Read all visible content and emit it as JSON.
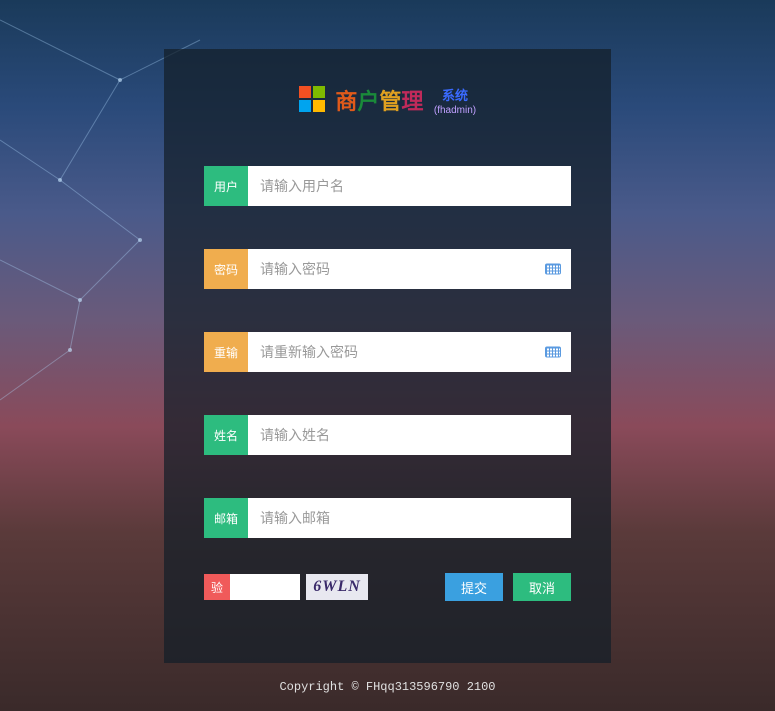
{
  "title": {
    "c1": "商",
    "c2": "户",
    "c3": "管",
    "c4": "理",
    "sub1": "系统",
    "sub2": "(fhadmin)"
  },
  "fields": {
    "username": {
      "label": "用户",
      "placeholder": "请输入用户名",
      "color": "green"
    },
    "password": {
      "label": "密码",
      "placeholder": "请输入密码",
      "color": "orange"
    },
    "repassword": {
      "label": "重输",
      "placeholder": "请重新输入密码",
      "color": "orange"
    },
    "realname": {
      "label": "姓名",
      "placeholder": "请输入姓名",
      "color": "green"
    },
    "email": {
      "label": "邮箱",
      "placeholder": "请输入邮箱",
      "color": "green"
    }
  },
  "captcha": {
    "label": "验",
    "code": "6WLN"
  },
  "buttons": {
    "submit": "提交",
    "cancel": "取消"
  },
  "copyright": "Copyright © FHqq313596790 2100"
}
